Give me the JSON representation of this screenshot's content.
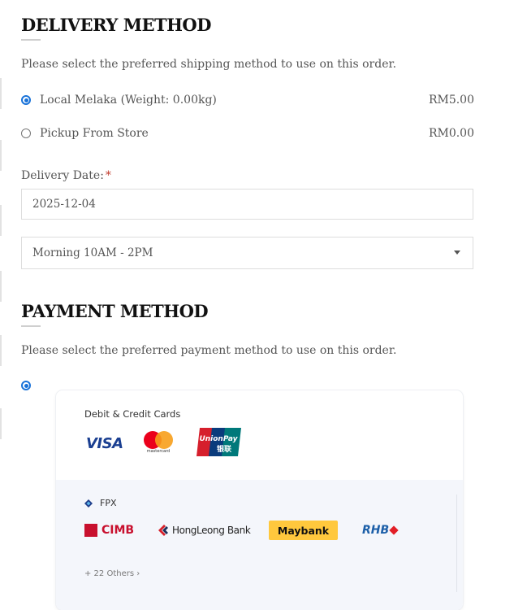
{
  "delivery": {
    "heading": "DELIVERY METHOD",
    "description": "Please select the preferred shipping method to use on this order.",
    "options": [
      {
        "label": "Local Melaka (Weight: 0.00kg)",
        "price": "RM5.00",
        "selected": true
      },
      {
        "label": "Pickup From Store",
        "price": "RM0.00",
        "selected": false
      }
    ],
    "date_label": "Delivery Date:",
    "required_mark": "*",
    "date_value": "2025-12-04",
    "time_slot": "Morning 10AM - 2PM"
  },
  "payment": {
    "heading": "PAYMENT METHOD",
    "description": "Please select the preferred payment method to use on this order.",
    "card_title": "Debit & Credit Cards",
    "card_brands": [
      "VISA",
      "mastercard",
      "UnionPay"
    ],
    "unionpay_chinese": "银联",
    "fpx_label": "FPX",
    "banks": [
      "CIMB",
      "HongLeong Bank",
      "Maybank",
      "RHB"
    ],
    "others_label": "+ 22 Others ›"
  },
  "colors": {
    "accent": "#1a73d9",
    "visa": "#1a3f91",
    "mastercard_red": "#eb001b",
    "mastercard_yellow": "#f79e1b",
    "cimb": "#c8102e",
    "maybank": "#ffc83d",
    "rhb": "#1c5fa8"
  }
}
